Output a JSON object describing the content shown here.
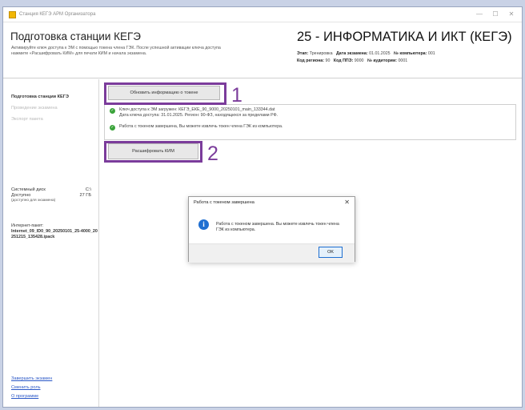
{
  "window": {
    "title": "Станция КЕГЭ АРМ Организатора",
    "minimize": "—",
    "maximize": "☐",
    "close": "✕"
  },
  "header": {
    "page_title": "Подготовка станции КЕГЭ",
    "description_1": "Активируйте ключ доступа к ЭМ с помощью токена члена ГЭК. После успешной активации ключа доступа",
    "description_2": "нажмите «Расшифровать КИМ» для печати КИМ и начала экзамена.",
    "subject": "25 - ИНФОРМАТИКА И ИКТ (КЕГЭ)",
    "stage_label": "Этап:",
    "stage_value": "Тренировка",
    "exam_date_label": "Дата экзамена:",
    "exam_date_value": "01.01.2025",
    "computer_label": "№ компьютера:",
    "computer_value": "001",
    "region_label": "Код региона:",
    "region_value": "90",
    "ppe_label": "Код ППЭ:",
    "ppe_value": "9000",
    "room_label": "№ аудитории:",
    "room_value": "0001"
  },
  "sidebar": {
    "items": [
      {
        "label": "Подготовка станции КЕГЭ"
      },
      {
        "label": "Проведение экзамена"
      },
      {
        "label": "Экспорт пакета"
      }
    ],
    "disk": {
      "system_label": "Системный диск",
      "system_value": "C:\\",
      "available_label": "Доступно",
      "available_value": "27 ГБ",
      "note": "(доступно для экзамена)"
    },
    "internet": {
      "label": "Интернет-пакет:",
      "file": "Internet_09_ID0_90_20250101_25-4000_20251215_135428.ipack"
    },
    "links": [
      {
        "label": "Завершить экзамен"
      },
      {
        "label": "Сменить роль"
      },
      {
        "label": "О программе"
      }
    ]
  },
  "main": {
    "update_button": "Обновить информацию о токене",
    "decrypt_button": "Расшифровать КИМ",
    "status": [
      {
        "line1": "Ключ доступа к ЭМ загружен: КЕГЭ_ЕКЕ_90_9000_20250101_main_133344.dat",
        "line2": "Дата ключа доступа: 31.01.2025. Регион: 90-ФЗ, находящихся за пределами РФ."
      },
      {
        "line1": "Работа с токеном завершена, Вы можете извлечь токен члена ГЭК из компьютера."
      }
    ],
    "annotations": [
      "1",
      "2"
    ]
  },
  "dialog": {
    "title": "Работа с токеном завершена",
    "close": "✕",
    "message": "Работа с токеном завершена. Вы можете извлечь токен члена ГЭК из компьютера.",
    "ok_button": "OK"
  }
}
